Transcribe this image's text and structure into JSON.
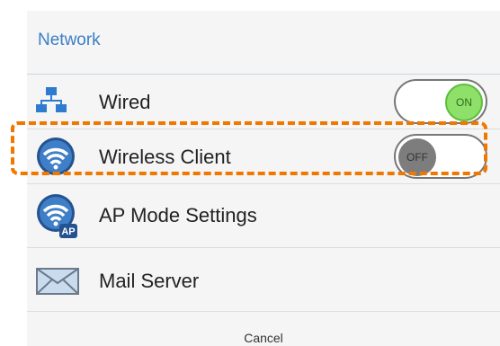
{
  "dialog": {
    "title": "Network",
    "items": [
      {
        "label": "Wired",
        "icon": "network-icon",
        "toggle": "ON"
      },
      {
        "label": "Wireless Client",
        "icon": "wifi-icon",
        "toggle": "OFF"
      },
      {
        "label": "AP Mode Settings",
        "icon": "wifi-ap-icon",
        "badge": "AP"
      },
      {
        "label": "Mail Server",
        "icon": "mail-icon"
      }
    ],
    "cancel_label": "Cancel"
  },
  "colors": {
    "title": "#3b7fc4",
    "highlight": "#f07800",
    "toggle_on": "#8ee06a",
    "toggle_off": "#7d7d7d"
  }
}
